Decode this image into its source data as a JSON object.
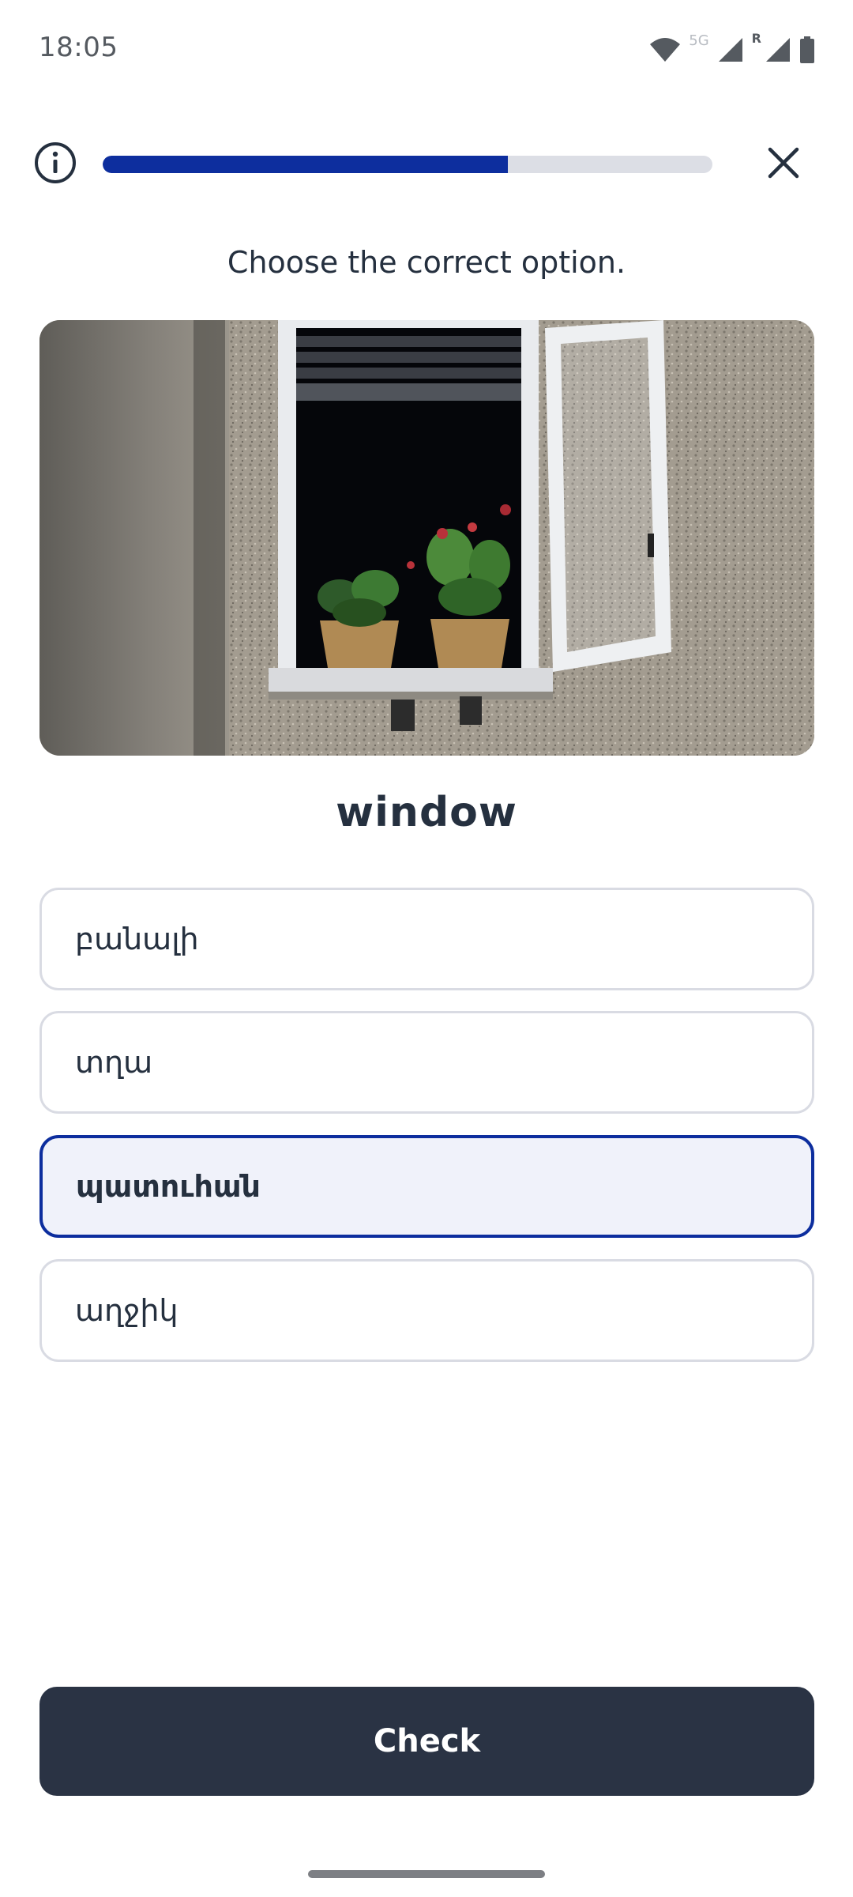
{
  "status_bar": {
    "time": "18:05",
    "network_label": "5G",
    "roaming_label": "R",
    "icons": [
      "wifi-icon",
      "signal-icon",
      "signal-roaming-icon",
      "battery-icon"
    ]
  },
  "header": {
    "progress_fraction": 0.665,
    "info_icon": "info-icon",
    "close_icon": "close-icon"
  },
  "exercise": {
    "instruction": "Choose the correct option.",
    "image_subject": "window",
    "prompt_word": "window",
    "options": [
      {
        "label": "բանալի",
        "selected": false
      },
      {
        "label": "տղա",
        "selected": false
      },
      {
        "label": "պատուհան",
        "selected": true
      },
      {
        "label": "աղջիկ",
        "selected": false
      }
    ],
    "check_label": "Check"
  },
  "colors": {
    "accent": "#0d2e9e",
    "progress_track": "#dcdee5",
    "button_dark": "#2a3344",
    "text": "#25303f"
  }
}
